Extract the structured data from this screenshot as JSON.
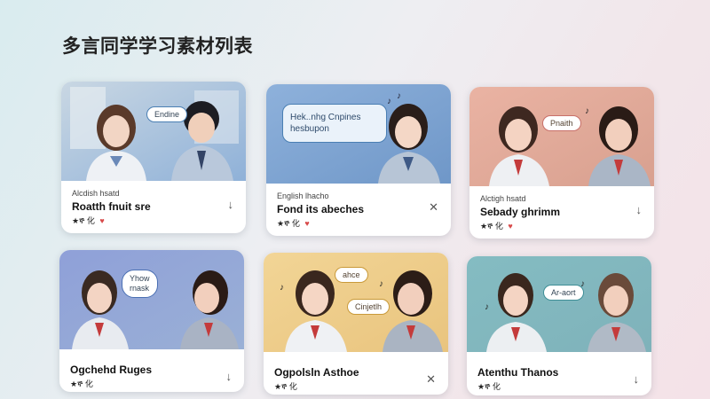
{
  "page": {
    "title": "多言同学学习素材列表"
  },
  "cards": [
    {
      "bubble": "Endine",
      "bubble2": "",
      "tagline": "Alcdish hsatd",
      "name": "Roatth fnuit sre",
      "rating": "★ኞ 化 ",
      "heart": "♥",
      "action_icon": "download-icon",
      "action": "↓"
    },
    {
      "bubble": "Hek..nhg Cnpines\nhesbupon",
      "bubble2": "",
      "tagline": "English lhacho",
      "name": "Fond its abeches",
      "rating": "★ኞ 化 ",
      "heart": "♥",
      "action_icon": "close-icon",
      "action": "✕"
    },
    {
      "bubble": "Pnaith",
      "bubble2": "",
      "tagline": "Alctigh hsatd",
      "name": "Sebady ghrimm",
      "rating": "★ኞ 化 ",
      "heart": "♥",
      "action_icon": "download-icon",
      "action": "↓"
    },
    {
      "bubble": "Yhow\nrnask",
      "bubble2": "",
      "tagline": "",
      "name": "Ogchehd Ruges",
      "rating": "★ኞ 化 ",
      "heart": "",
      "action_icon": "download-icon",
      "action": "↓"
    },
    {
      "bubble": "ahce",
      "bubble2": "Cinjetlh",
      "tagline": "",
      "name": "Ogpolsln Asthoe",
      "rating": "★ኞ 化 ",
      "heart": "",
      "action_icon": "close-icon",
      "action": "✕"
    },
    {
      "bubble": "Ar-aort",
      "bubble2": "",
      "tagline": "",
      "name": "Atenthu Thanos",
      "rating": "★ኞ 化 ",
      "heart": "",
      "action_icon": "download-icon",
      "action": "↓"
    }
  ],
  "colors": {
    "card1_bg": "#9fb9d6",
    "card2_bg": "#7fa3cf",
    "card3_bg": "#e8ab9a",
    "card4_bg": "#8d9fd3",
    "card5_bg": "#efcf8c",
    "card6_bg": "#7fb8bf"
  }
}
